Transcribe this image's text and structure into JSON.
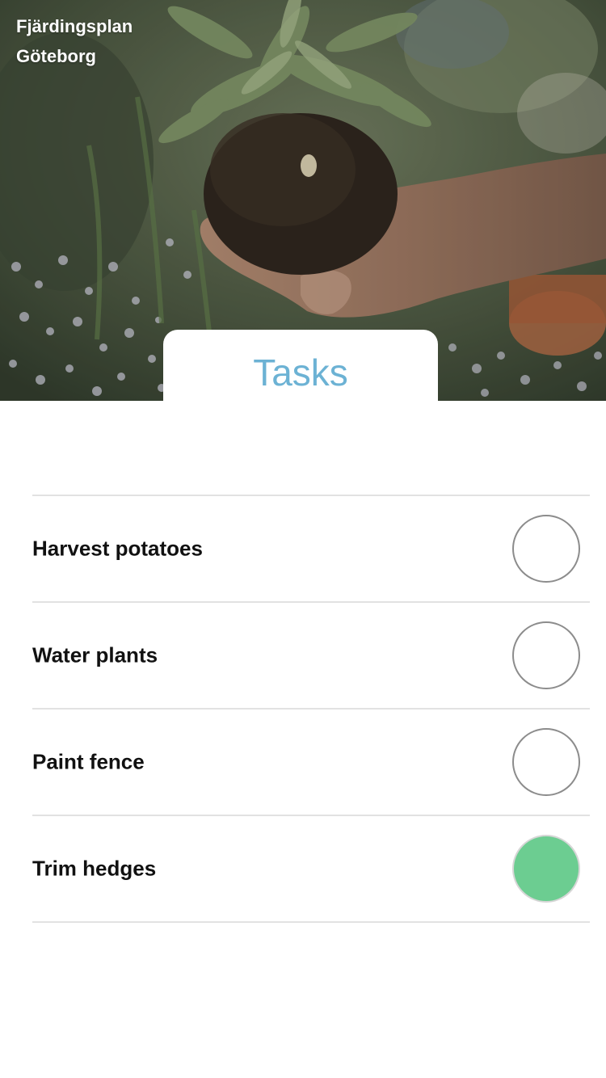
{
  "header": {
    "location_line1": "Fjärdingsplan",
    "location_line2": "Göteborg",
    "hero_image": "hand-holding-plant-with-soil"
  },
  "tab": {
    "label": "Tasks"
  },
  "colors": {
    "tab_text": "#6cb2d4",
    "done_fill": "#6ccd91",
    "divider": "#e2e2e2",
    "check_border": "#8c8c8c"
  },
  "tasks": [
    {
      "label": "Harvest potatoes",
      "done": false
    },
    {
      "label": "Water plants",
      "done": false
    },
    {
      "label": "Paint fence",
      "done": false
    },
    {
      "label": "Trim hedges",
      "done": true
    }
  ]
}
